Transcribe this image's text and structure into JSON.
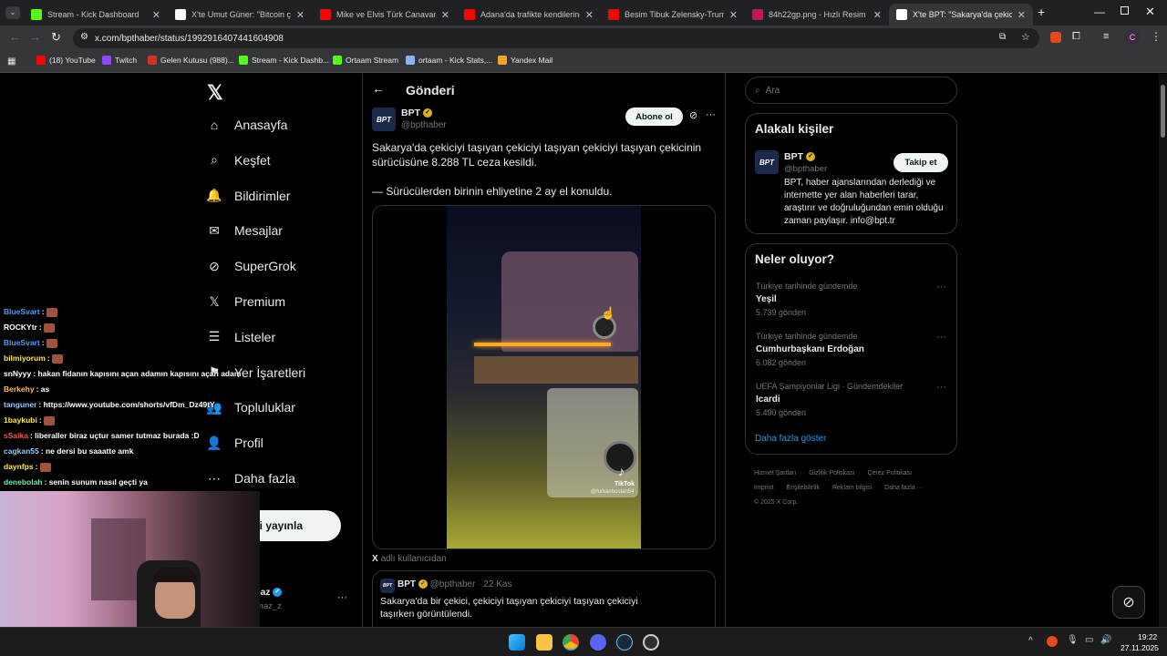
{
  "tabs": [
    {
      "title": "Stream - Kick Dashboard",
      "icon": "kick-icon",
      "color": "#53fc18"
    },
    {
      "title": "X'te Umut Güner: \"Bitcoin çöküş",
      "icon": "x-icon",
      "color": "#ffffff"
    },
    {
      "title": "Mike ve Elvis Türk Canavan An",
      "icon": "youtube-icon",
      "color": "#ff0000"
    },
    {
      "title": "Adana'da trafikte kendilerine sı",
      "icon": "youtube-icon",
      "color": "#ff0000"
    },
    {
      "title": "Besim Tibuk Zelensky-Trump O",
      "icon": "youtube-icon",
      "color": "#ff0000"
    },
    {
      "title": "84h22gp.png - Hızlı Resim",
      "icon": "image-icon",
      "color": "#c2185b"
    },
    {
      "title": "X'te BPT: \"Sakarya'da çekic",
      "icon": "x-icon",
      "color": "#ffffff"
    }
  ],
  "browser": {
    "url": "x.com/bpthaber/status/1992916407441604908",
    "new_tab": "+",
    "profile_letter": "C"
  },
  "bookmarks": [
    {
      "label": "(18) YouTube",
      "color": "#ff0000"
    },
    {
      "label": "Twitch",
      "color": "#9146ff"
    },
    {
      "label": "Gelen Kutusu (988)...",
      "color": "#d93025"
    },
    {
      "label": "Stream - Kick Dashb...",
      "color": "#53fc18"
    },
    {
      "label": "Ortaam Stream",
      "color": "#53fc18"
    },
    {
      "label": "ortaam - Kick Stats,...",
      "color": "#8ab4f8"
    },
    {
      "label": "Yandex Mail",
      "color": "#f5a623"
    }
  ],
  "nav": {
    "items": [
      {
        "label": "Anasayfa",
        "icon": "home-icon"
      },
      {
        "label": "Keşfet",
        "icon": "search-icon"
      },
      {
        "label": "Bildirimler",
        "icon": "bell-icon"
      },
      {
        "label": "Mesajlar",
        "icon": "mail-icon"
      },
      {
        "label": "SuperGrok",
        "icon": "grok-icon"
      },
      {
        "label": "Premium",
        "icon": "x-icon"
      },
      {
        "label": "Listeler",
        "icon": "list-icon"
      },
      {
        "label": "Yer İşaretleri",
        "icon": "bookmark-icon"
      },
      {
        "label": "Topluluklar",
        "icon": "people-icon"
      },
      {
        "label": "Profil",
        "icon": "person-icon"
      },
      {
        "label": "Daha fazla",
        "icon": "more-icon"
      }
    ],
    "post_button": "Gönderi yayınla",
    "account_name": "Mehmetyilmaz",
    "account_handle": "@mehmetyilmaz_z",
    "account_more": "···"
  },
  "post": {
    "header_title": "Gönderi",
    "author_name": "BPT",
    "author_handle": "@bpthaber",
    "avatar_text": "BPT",
    "subscribe_button": "Abone ol",
    "text_line1": "Sakarya'da çekiciyi taşıyan çekiciyi taşıyan çekiciyi taşıyan çekicinin",
    "text_line2": "sürücüsüne 8.288 TL ceza kesildi.",
    "text_line3": "— Sürücülerden birinin ehliyetine 2 ay el konuldu.",
    "video_watermark": "TikTok",
    "video_user": "@furkanbostan54",
    "from_user_prefix": "X",
    "from_user": "adlı kullanıcıdan",
    "quoted": {
      "name": "BPT",
      "handle": "@bpthaber",
      "date": "· 22 Kas",
      "text_line1": "Sakarya'da bir çekici, çekiciyi taşıyan çekiciyi taşıyan çekiciyi",
      "text_line2": "taşırken görüntülendi."
    }
  },
  "sidebar": {
    "search_placeholder": "Ara",
    "related_title": "Alakalı kişiler",
    "related": {
      "name": "BPT",
      "handle": "@bpthaber",
      "follow_button": "Takip et",
      "bio_line1": "BPT, haber ajanslarından derlediği ve",
      "bio_line2": "internette yer alan haberleri tarar,",
      "bio_line3": "araştırır ve doğruluğundan emin olduğu",
      "bio_line4": "zaman paylaşır. info@bpt.tr"
    },
    "trends_title": "Neler oluyor?",
    "trends": [
      {
        "category": "Türkiye tarihinde gündemde",
        "name": "Yeşil",
        "count": "5.739 gönderi"
      },
      {
        "category": "Türkiye tarihinde gündemde",
        "name": "Cumhurbaşkanı Erdoğan",
        "count": "6.082 gönderi"
      },
      {
        "category": "UEFA Şampiyonlar Ligi · Gündemdekiler",
        "name": "Icardi",
        "count": "5.490 gönderi"
      }
    ],
    "show_more": "Daha fazla göster",
    "footer_row1": [
      "Hizmet Şartları",
      "Gizlilik Politikası",
      "Çerez Politikası"
    ],
    "footer_row2": [
      "Imprint",
      "Erişilebilirlik",
      "Reklam bilgisi",
      "Daha fazla ···"
    ],
    "copyright": "© 2025 X Corp."
  },
  "chat": [
    {
      "user": "BlueSvart",
      "msg": ":",
      "color": "#4a9eff",
      "emote": true
    },
    {
      "user": "ROCKYtr",
      "msg": ":",
      "color": "#ffffff",
      "emote": true
    },
    {
      "user": "BlueSvart",
      "msg": ":",
      "color": "#4a9eff",
      "emote": true
    },
    {
      "user": "bilmiyorum",
      "msg": ":",
      "color": "#ffeb3b",
      "emote": true
    },
    {
      "user": "snNyyy",
      "msg": ": hakan fidanın kapısını açan adamın kapısını açan adam",
      "color": "#ffffff",
      "emote": false
    },
    {
      "user": "Berkehy",
      "msg": ": as",
      "color": "#ffb74d",
      "emote": false
    },
    {
      "user": "tanguner",
      "msg": ": https://www.youtube.com/shorts/vfDm_Dz49tY",
      "color": "#90caf9",
      "emote": false
    },
    {
      "user": "1baykubi",
      "msg": ":",
      "color": "#ffeb3b",
      "emote": true
    },
    {
      "user": "sSaika",
      "msg": ": liberaller biraz uçtur samer tutmaz burada :D",
      "color": "#ff5252",
      "emote": false
    },
    {
      "user": "cagkan55",
      "msg": ": ne dersi bu saaatte amk",
      "color": "#90caf9",
      "emote": false
    },
    {
      "user": "daynfps",
      "msg": ":",
      "color": "#ffeb3b",
      "emote": true
    },
    {
      "user": "denebolah",
      "msg": ": senin sunum nasıl geçti ya",
      "color": "#69f0ae",
      "emote": false
    }
  ],
  "taskbar": {
    "time": "19:22",
    "date": "27.11.2025"
  }
}
